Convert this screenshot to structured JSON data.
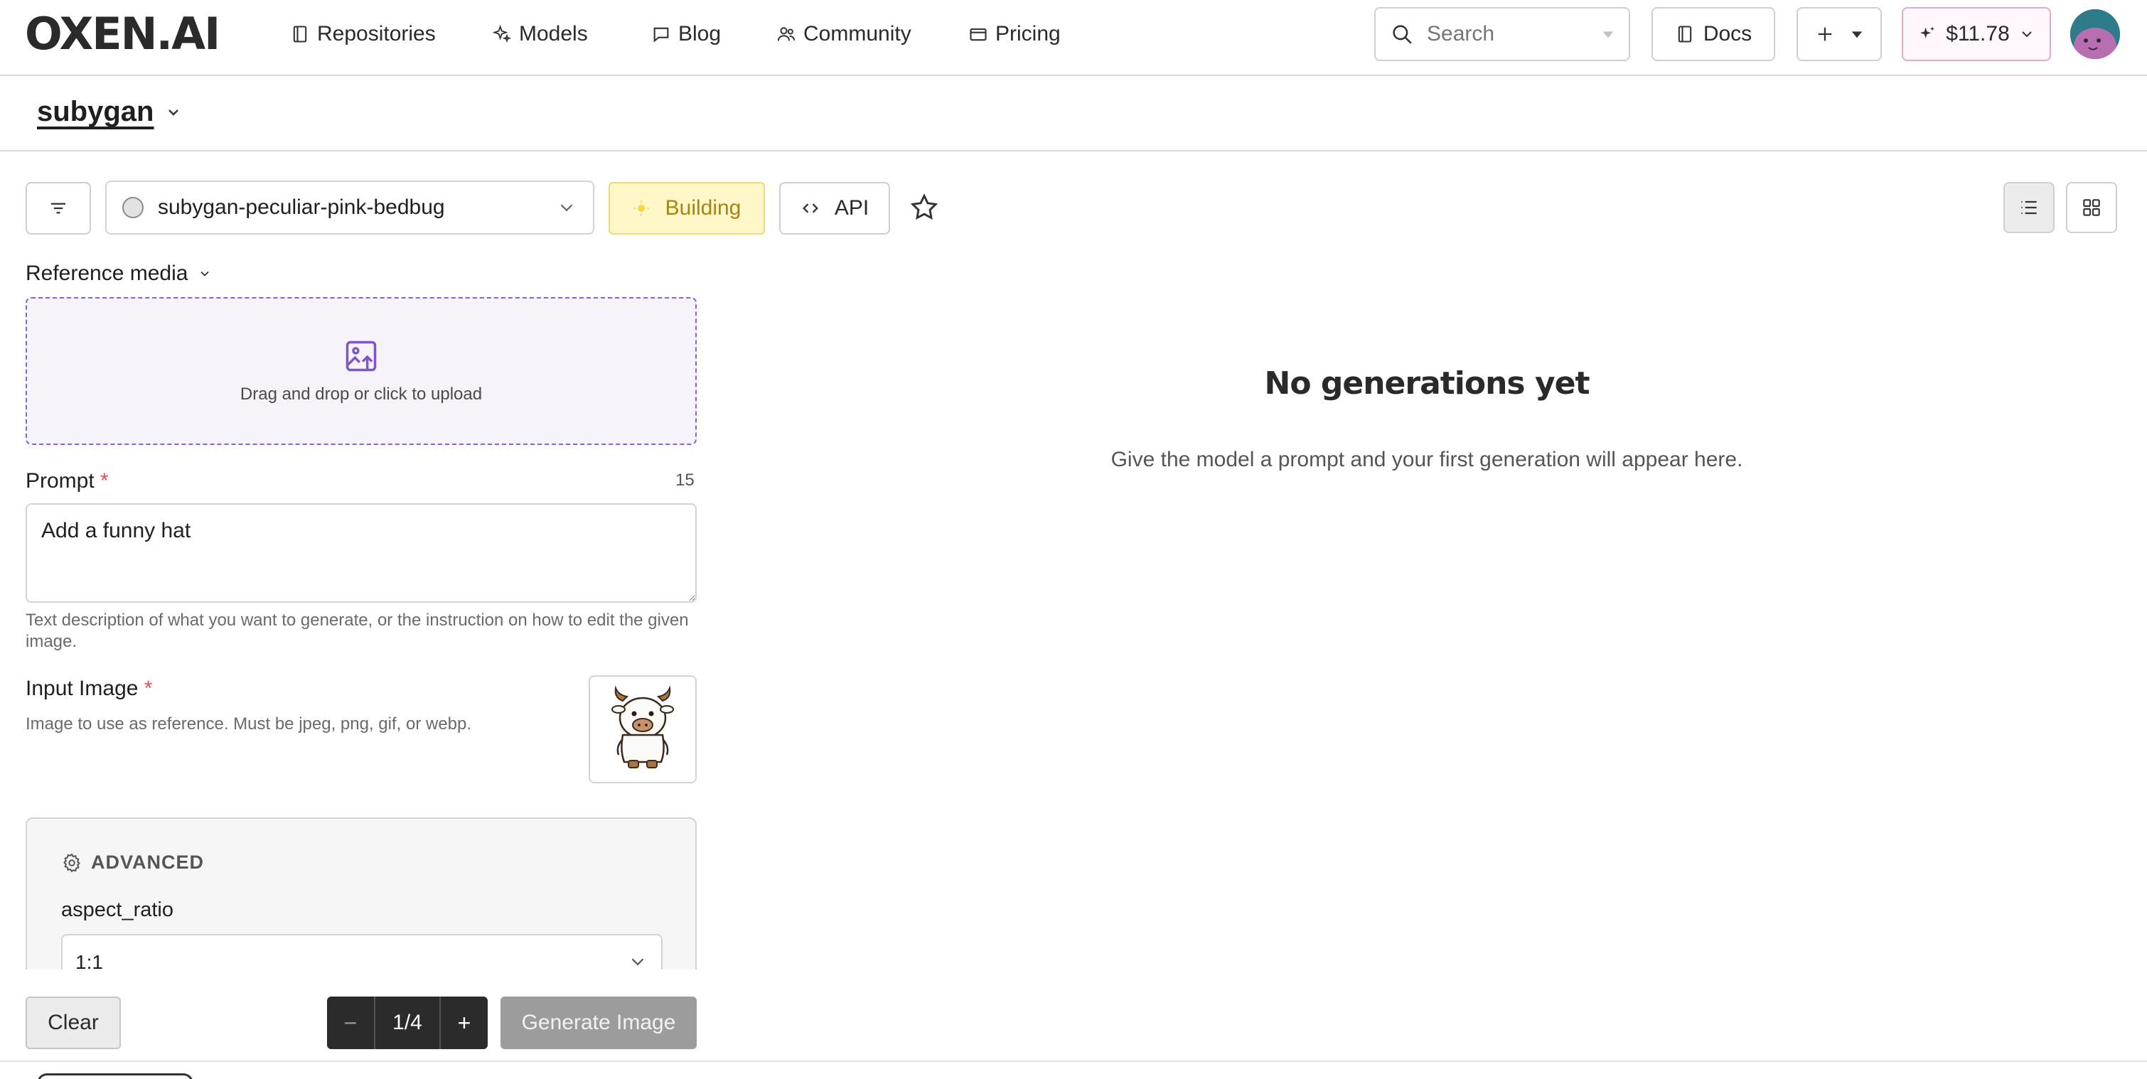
{
  "nav": {
    "logo": "OXEN.AI",
    "links": [
      {
        "label": "Repositories",
        "icon": "book-icon"
      },
      {
        "label": "Models",
        "icon": "sparkles-icon"
      },
      {
        "label": "Blog",
        "icon": "chat-bubble-icon"
      },
      {
        "label": "Community",
        "icon": "users-icon"
      },
      {
        "label": "Pricing",
        "icon": "credit-card-icon"
      }
    ],
    "search_placeholder": "Search",
    "docs_label": "Docs",
    "credits": "$11.78"
  },
  "repo": {
    "owner": "subygan"
  },
  "toolbar": {
    "model_name": "subygan-peculiar-pink-bedbug",
    "status": "Building",
    "api_label": "API"
  },
  "form": {
    "reference_label": "Reference media",
    "upload_text": "Drag and drop or click to upload",
    "prompt_label": "Prompt",
    "prompt_required": "*",
    "prompt_count": "15",
    "prompt_value": "Add a funny hat",
    "prompt_help": "Text description of what you want to generate, or the instruction on how to edit the given image.",
    "input_image_label": "Input Image",
    "input_image_required": "*",
    "input_image_help": "Image to use as reference. Must be jpeg, png, gif, or webp.",
    "advanced_title": "ADVANCED",
    "aspect_ratio_label": "aspect_ratio",
    "aspect_ratio_value": "1:1"
  },
  "actions": {
    "clear_label": "Clear",
    "count_minus": "−",
    "count_value": "1/4",
    "count_plus": "+",
    "generate_label": "Generate Image"
  },
  "empty_state": {
    "title": "No generations yet",
    "subtitle": "Give the model a prompt and your first generation will appear here."
  },
  "colors": {
    "accent_purple": "#8a62d4",
    "building_bg": "#fff7c7",
    "building_text": "#a88510",
    "required": "#e05252"
  }
}
